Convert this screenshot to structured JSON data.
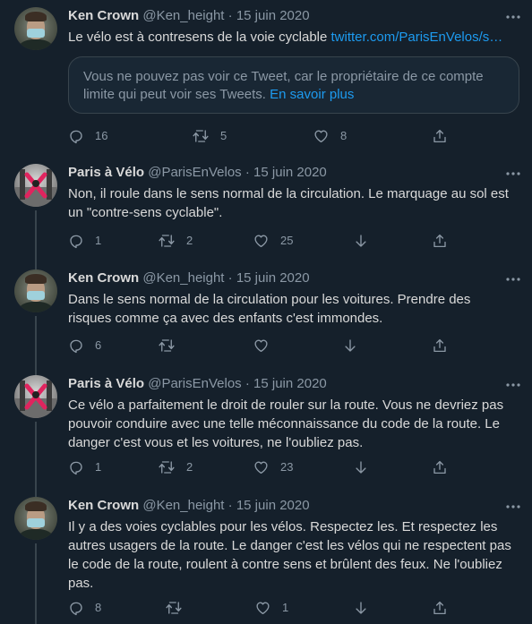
{
  "tweets": [
    {
      "avatar": "ken",
      "name": "Ken Crown",
      "handle": "@Ken_height",
      "sep": "·",
      "date": "15 juin 2020",
      "text": "Le vélo est à contresens de la voie cyclable ",
      "link": "twitter.com/ParisEnVelos/s…",
      "notice": {
        "text": "Vous ne pouvez pas voir ce Tweet, car le propriétaire de ce compte limite qui peut voir ses Tweets. ",
        "link": "En savoir plus"
      },
      "replies": "16",
      "retweets": "5",
      "likes": "8",
      "has_downvote": false
    },
    {
      "avatar": "pav",
      "name": "Paris à Vélo",
      "handle": "@ParisEnVelos",
      "sep": "·",
      "date": "15 juin 2020",
      "text": "Non, il roule dans le sens normal de la circulation. Le marquage au sol est un \"contre-sens cyclable\".",
      "replies": "1",
      "retweets": "2",
      "likes": "25",
      "has_downvote": true
    },
    {
      "avatar": "ken",
      "name": "Ken Crown",
      "handle": "@Ken_height",
      "sep": "·",
      "date": "15 juin 2020",
      "text": "Dans le sens normal de la circulation pour les voitures. Prendre des risques comme ça avec des enfants c'est immondes.",
      "replies": "6",
      "retweets": "",
      "likes": "",
      "has_downvote": true
    },
    {
      "avatar": "pav",
      "name": "Paris à Vélo",
      "handle": "@ParisEnVelos",
      "sep": "·",
      "date": "15 juin 2020",
      "text": "Ce vélo a parfaitement le droit de rouler sur la route. Vous ne devriez pas pouvoir conduire avec une telle méconnaissance du code de la route. Le danger c'est vous et les voitures, ne l'oubliez pas.",
      "replies": "1",
      "retweets": "2",
      "likes": "23",
      "has_downvote": true
    },
    {
      "avatar": "ken",
      "name": "Ken Crown",
      "handle": "@Ken_height",
      "sep": "·",
      "date": "15 juin 2020",
      "text": "Il y a des voies cyclables pour les vélos. Respectez les. Et respectez les autres usagers de la route. Le danger c'est les vélos qui ne respectent pas le code de la route, roulent à contre sens et brûlent des feux. Ne l'oubliez pas.",
      "replies": "8",
      "retweets": "",
      "likes": "1",
      "has_downvote": true
    }
  ],
  "colors": {
    "background": "#15202b",
    "text": "#d9d9d9",
    "muted": "#8b98a5",
    "link": "#1d9bf0",
    "border": "#38444d"
  }
}
